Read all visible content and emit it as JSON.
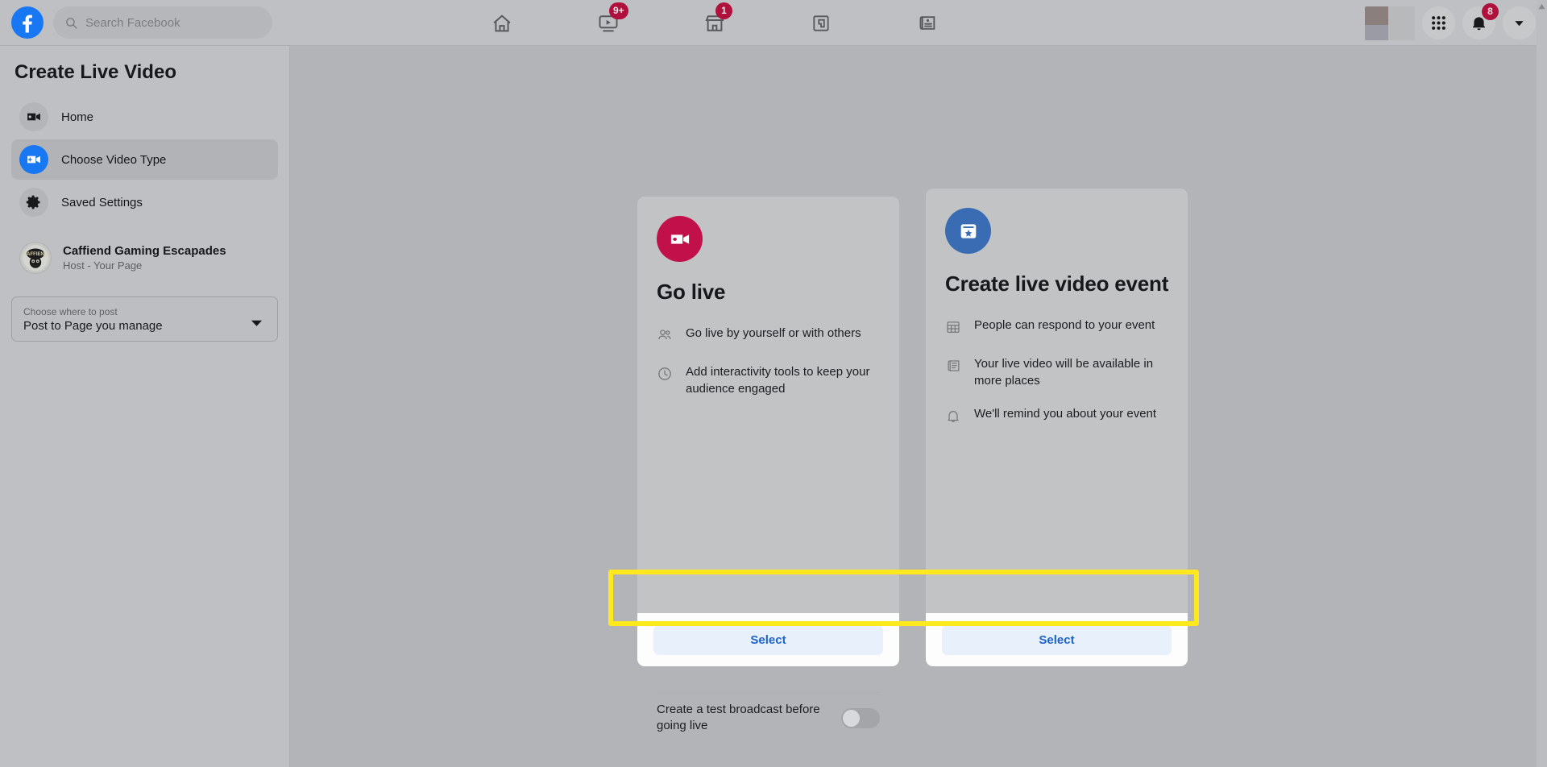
{
  "topbar": {
    "logo_icon": "facebook-logo-icon",
    "search": {
      "icon": "search-icon",
      "placeholder": "Search Facebook"
    },
    "nav_items": [
      {
        "icon": "home-icon",
        "name": "home",
        "badge": ""
      },
      {
        "icon": "video-play-icon",
        "name": "video",
        "badge": "9+"
      },
      {
        "icon": "marketplace-store-icon",
        "name": "marketplace",
        "badge": "1"
      },
      {
        "icon": "gaming-controller-icon",
        "name": "gaming",
        "badge": ""
      },
      {
        "icon": "news-feed-icon",
        "name": "news",
        "badge": ""
      }
    ],
    "avatar_label": "profile-avatar",
    "menu_icon": "grid-menu-icon",
    "notifications_icon": "bell-icon",
    "notifications_badge": "8",
    "account_icon": "chevron-down-icon"
  },
  "sidebar": {
    "title": "Create Live Video",
    "items": [
      {
        "label": "Home",
        "icon": "video-camera-icon",
        "active": false
      },
      {
        "label": "Choose Video Type",
        "icon": "video-camera-plus-icon",
        "active": true
      },
      {
        "label": "Saved Settings",
        "icon": "gear-icon",
        "active": false
      }
    ],
    "page": {
      "name": "Caffiend Gaming Escapades",
      "role": "Host - Your Page",
      "avatar_icon": "page-avatar-icon"
    },
    "post_select": {
      "label": "Choose where to post",
      "value": "Post to Page you manage",
      "caret_icon": "caret-down-icon"
    }
  },
  "cards": [
    {
      "id": "golive",
      "icon": "video-camera-icon",
      "icon_color": "#c2104a",
      "title": "Go live",
      "features": [
        {
          "icon": "people-icon",
          "text": "Go live by yourself or with others"
        },
        {
          "icon": "clock-icon",
          "text": "Add interactivity tools to keep your audience engaged"
        }
      ],
      "toggle": {
        "label": "Create a test broadcast before going live",
        "on": false
      },
      "select_label": "Select"
    },
    {
      "id": "event",
      "icon": "calendar-star-icon",
      "icon_color": "#3a6cb4",
      "title": "Create live video event",
      "features": [
        {
          "icon": "calendar-grid-icon",
          "text": "People can respond to your event"
        },
        {
          "icon": "news-article-icon",
          "text": "Your live video will be available in more places"
        },
        {
          "icon": "bell-icon",
          "text": "We'll remind you about your event"
        }
      ],
      "select_label": "Select"
    }
  ],
  "annotation": {
    "color": "#ffe81c",
    "name": "select-buttons-highlight"
  }
}
